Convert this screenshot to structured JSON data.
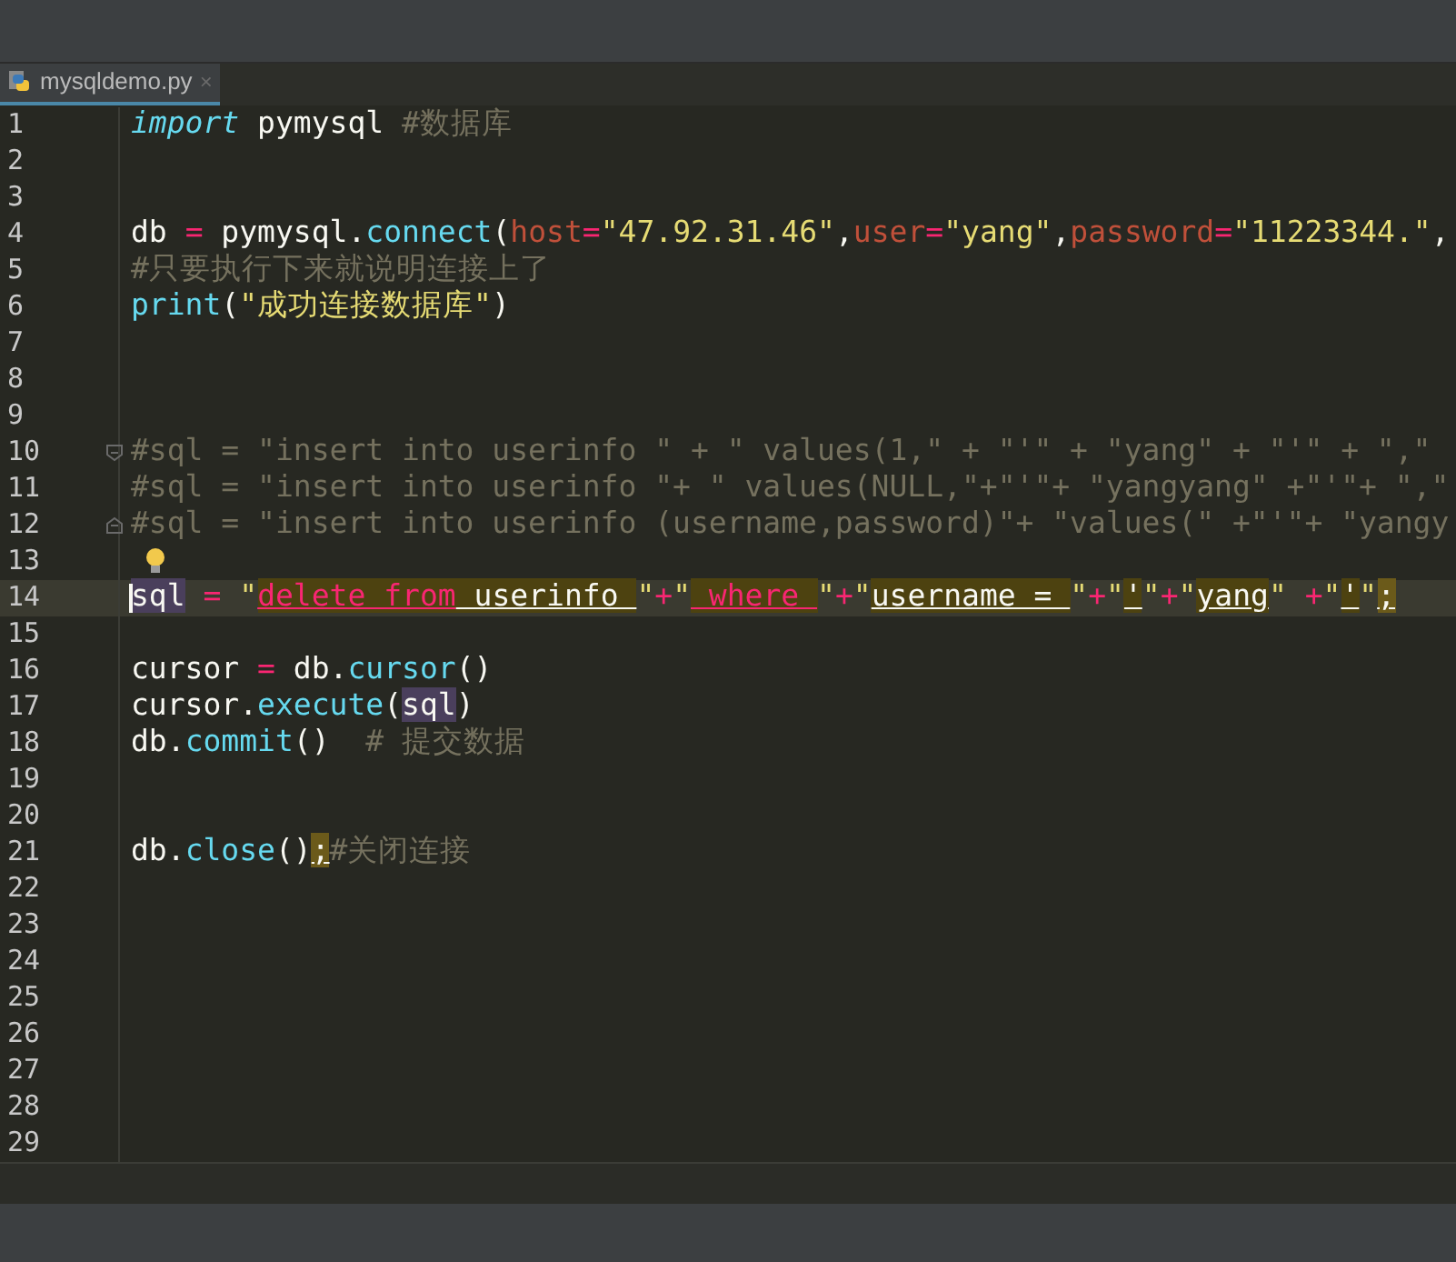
{
  "tabs": [
    {
      "label": "mysqldemo.py",
      "close": "×",
      "selected": true
    }
  ],
  "lines": [
    {
      "number": "1",
      "current": false,
      "tokens": [
        {
          "kind": "keyword",
          "text": "import"
        },
        {
          "kind": "plain",
          "text": " pymysql "
        },
        {
          "kind": "comment",
          "text": "#数据库"
        }
      ]
    },
    {
      "number": "2",
      "current": false
    },
    {
      "number": "3",
      "current": false
    },
    {
      "number": "4",
      "current": false,
      "tokens": [
        {
          "kind": "plain",
          "text": "db "
        },
        {
          "kind": "op",
          "text": "="
        },
        {
          "kind": "plain",
          "text": " pymysql."
        },
        {
          "kind": "func",
          "text": "connect"
        },
        {
          "kind": "plain",
          "text": "("
        },
        {
          "kind": "param",
          "text": "host"
        },
        {
          "kind": "op",
          "text": "="
        },
        {
          "kind": "string",
          "text": "\"47.92.31.46\""
        },
        {
          "kind": "plain",
          "text": ","
        },
        {
          "kind": "param",
          "text": "user"
        },
        {
          "kind": "op",
          "text": "="
        },
        {
          "kind": "string",
          "text": "\"yang\""
        },
        {
          "kind": "plain",
          "text": ","
        },
        {
          "kind": "param",
          "text": "password"
        },
        {
          "kind": "op",
          "text": "="
        },
        {
          "kind": "string",
          "text": "\"11223344.\""
        },
        {
          "kind": "plain",
          "text": ","
        }
      ]
    },
    {
      "number": "5",
      "current": false,
      "tokens": [
        {
          "kind": "comment",
          "text": "#只要执行下来就说明连接上了"
        }
      ]
    },
    {
      "number": "6",
      "current": false,
      "tokens": [
        {
          "kind": "func-builtin",
          "text": "print"
        },
        {
          "kind": "plain",
          "text": "("
        },
        {
          "kind": "string",
          "text": "\"成功连接数据库\""
        },
        {
          "kind": "plain",
          "text": ")"
        }
      ]
    },
    {
      "number": "7",
      "current": false
    },
    {
      "number": "8",
      "current": false
    },
    {
      "number": "9",
      "current": false
    },
    {
      "number": "10",
      "current": false,
      "fold_start": true,
      "tokens": [
        {
          "kind": "comment",
          "text": "#sql = \"insert into userinfo \" + \" values(1,\" + \"'\" + \"yang\" + \"'\" + \",\""
        }
      ]
    },
    {
      "number": "11",
      "current": false,
      "tokens": [
        {
          "kind": "comment",
          "text": "#sql = \"insert into userinfo \"+ \" values(NULL,\"+\"'\"+ \"yangyang\" +\"'\"+ \",\""
        }
      ]
    },
    {
      "number": "12",
      "current": false,
      "fold_end": true,
      "tokens": [
        {
          "kind": "comment",
          "text": "#sql = \"insert into userinfo (username,password)\"+ \"values(\" +\"'\"+ \"yangy"
        }
      ]
    },
    {
      "number": "13",
      "current": false,
      "bulb": true
    },
    {
      "number": "14",
      "current": true,
      "tokens": [
        {
          "kind": "selected-var",
          "text": "sql"
        },
        {
          "kind": "op",
          "text": " ="
        },
        {
          "kind": "string",
          "text": " \""
        },
        {
          "kind": "sql-keyword",
          "text": "delete from"
        },
        {
          "kind": "sql-text",
          "text": " userinfo "
        },
        {
          "kind": "sql-quote",
          "text": "\""
        },
        {
          "kind": "sql-op",
          "text": "+"
        },
        {
          "kind": "sql-quote",
          "text": "\""
        },
        {
          "kind": "sql-keyword",
          "text": " where "
        },
        {
          "kind": "sql-quote",
          "text": "\""
        },
        {
          "kind": "sql-op",
          "text": "+"
        },
        {
          "kind": "sql-quote",
          "text": "\""
        },
        {
          "kind": "sql-text",
          "text": "username = "
        },
        {
          "kind": "sql-quote",
          "text": "\""
        },
        {
          "kind": "sql-op",
          "text": "+"
        },
        {
          "kind": "sql-quote",
          "text": "\""
        },
        {
          "kind": "sql-text",
          "text": "'"
        },
        {
          "kind": "sql-quote",
          "text": "\""
        },
        {
          "kind": "sql-op",
          "text": "+"
        },
        {
          "kind": "sql-quote",
          "text": "\""
        },
        {
          "kind": "sql-text",
          "text": "yang"
        },
        {
          "kind": "sql-quote",
          "text": "\" "
        },
        {
          "kind": "sql-op",
          "text": "+"
        },
        {
          "kind": "sql-quote",
          "text": "\""
        },
        {
          "kind": "sql-text",
          "text": "'"
        },
        {
          "kind": "sql-quote",
          "text": "\""
        },
        {
          "kind": "warn",
          "text": ";"
        }
      ]
    },
    {
      "number": "15",
      "current": false
    },
    {
      "number": "16",
      "current": false,
      "tokens": [
        {
          "kind": "plain",
          "text": "cursor "
        },
        {
          "kind": "op",
          "text": "="
        },
        {
          "kind": "plain",
          "text": " db."
        },
        {
          "kind": "func",
          "text": "cursor"
        },
        {
          "kind": "plain",
          "text": "()"
        }
      ]
    },
    {
      "number": "17",
      "current": false,
      "tokens": [
        {
          "kind": "plain",
          "text": "cursor."
        },
        {
          "kind": "func",
          "text": "execute"
        },
        {
          "kind": "plain",
          "text": "("
        },
        {
          "kind": "selected-var",
          "text": "sql"
        },
        {
          "kind": "plain",
          "text": ")"
        }
      ]
    },
    {
      "number": "18",
      "current": false,
      "tokens": [
        {
          "kind": "plain",
          "text": "db."
        },
        {
          "kind": "func",
          "text": "commit"
        },
        {
          "kind": "plain",
          "text": "()  "
        },
        {
          "kind": "comment",
          "text": "# 提交数据"
        }
      ]
    },
    {
      "number": "19",
      "current": false
    },
    {
      "number": "20",
      "current": false
    },
    {
      "number": "21",
      "current": false,
      "tokens": [
        {
          "kind": "plain",
          "text": "db."
        },
        {
          "kind": "func",
          "text": "close"
        },
        {
          "kind": "plain",
          "text": "()"
        },
        {
          "kind": "warn",
          "text": ";"
        },
        {
          "kind": "comment",
          "text": "#关闭连接"
        }
      ]
    },
    {
      "number": "22",
      "current": false
    },
    {
      "number": "23",
      "current": false
    },
    {
      "number": "24",
      "current": false
    },
    {
      "number": "25",
      "current": false
    },
    {
      "number": "26",
      "current": false
    },
    {
      "number": "27",
      "current": false
    },
    {
      "number": "28",
      "current": false
    },
    {
      "number": "29",
      "current": false
    }
  ]
}
